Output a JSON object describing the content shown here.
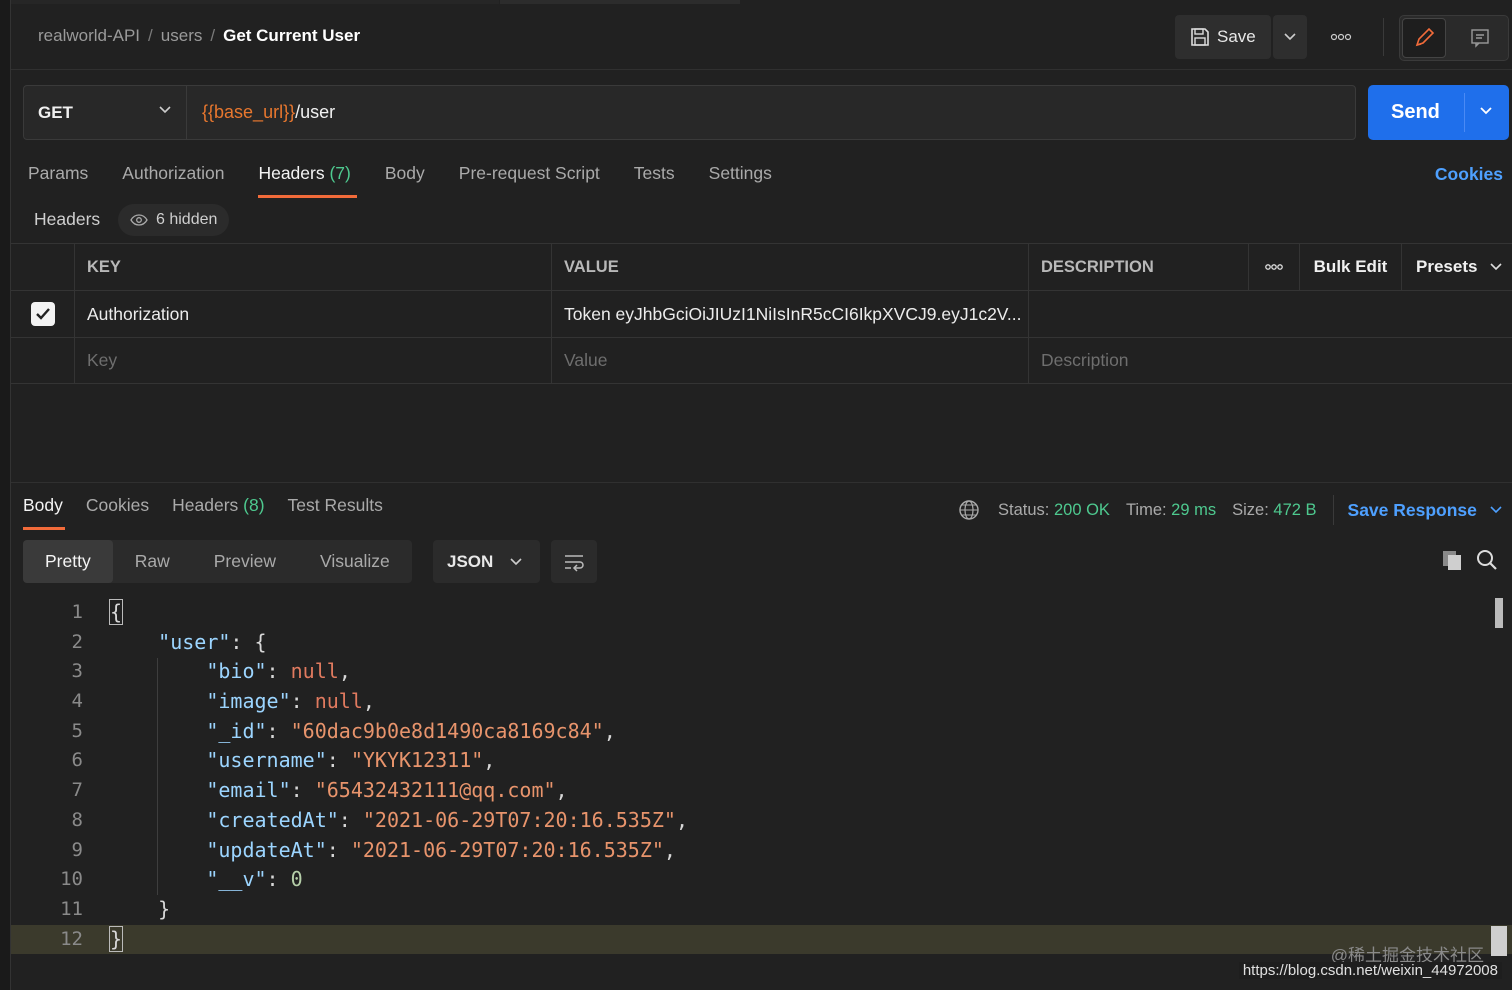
{
  "breadcrumb": {
    "collection": "realworld-API",
    "folder": "users",
    "request": "Get Current User",
    "separator": "/"
  },
  "toolbar": {
    "save_label": "Save",
    "more_icon": "more-icon"
  },
  "request": {
    "method": "GET",
    "url_var": "{{base_url}}",
    "url_path": "/user",
    "send_label": "Send"
  },
  "request_tabs": [
    {
      "label": "Params"
    },
    {
      "label": "Authorization"
    },
    {
      "label": "Headers",
      "count": "(7)",
      "active": true
    },
    {
      "label": "Body"
    },
    {
      "label": "Pre-request Script"
    },
    {
      "label": "Tests"
    },
    {
      "label": "Settings"
    }
  ],
  "cookies_label": "Cookies",
  "headers_section": {
    "title": "Headers",
    "hidden_label": "6 hidden"
  },
  "headers_table": {
    "columns": {
      "key": "KEY",
      "value": "VALUE",
      "description": "DESCRIPTION",
      "bulk_edit": "Bulk Edit",
      "presets": "Presets"
    },
    "rows": [
      {
        "checked": true,
        "key": "Authorization",
        "value": "Token eyJhbGciOiJIUzI1NiIsInR5cCI6IkpXVCJ9.eyJ1c2V...",
        "description": ""
      }
    ],
    "placeholders": {
      "key": "Key",
      "value": "Value",
      "description": "Description"
    }
  },
  "response_tabs": [
    {
      "label": "Body",
      "active": true
    },
    {
      "label": "Cookies"
    },
    {
      "label": "Headers",
      "count": "(8)"
    },
    {
      "label": "Test Results"
    }
  ],
  "response_status": {
    "status_label": "Status:",
    "status_value": "200 OK",
    "time_label": "Time:",
    "time_value": "29 ms",
    "size_label": "Size:",
    "size_value": "472 B",
    "save_response": "Save Response"
  },
  "view_modes": [
    "Pretty",
    "Raw",
    "Preview",
    "Visualize"
  ],
  "format": "JSON",
  "code_lines": [
    "1",
    "2",
    "3",
    "4",
    "5",
    "6",
    "7",
    "8",
    "9",
    "10",
    "11",
    "12"
  ],
  "body": {
    "root_key": "\"user\"",
    "fields": [
      {
        "k": "\"bio\"",
        "v": "null",
        "t": "kw"
      },
      {
        "k": "\"image\"",
        "v": "null",
        "t": "kw"
      },
      {
        "k": "\"_id\"",
        "v": "\"60dac9b0e8d1490ca8169c84\"",
        "t": "str"
      },
      {
        "k": "\"username\"",
        "v": "\"YKYK12311\"",
        "t": "str"
      },
      {
        "k": "\"email\"",
        "v": "\"65432432111@qq.com\"",
        "t": "str"
      },
      {
        "k": "\"createdAt\"",
        "v": "\"2021-06-29T07:20:16.535Z\"",
        "t": "str"
      },
      {
        "k": "\"updateAt\"",
        "v": "\"2021-06-29T07:20:16.535Z\"",
        "t": "str"
      },
      {
        "k": "\"__v\"",
        "v": "0",
        "t": "num"
      }
    ]
  },
  "watermark": "@稀土掘金技术社区",
  "source_url": "https://blog.csdn.net/weixin_44972008",
  "colors": {
    "accent": "#f26b3a",
    "send": "#1f6feb",
    "link": "#4ea0ff",
    "success": "#4ec98f"
  }
}
